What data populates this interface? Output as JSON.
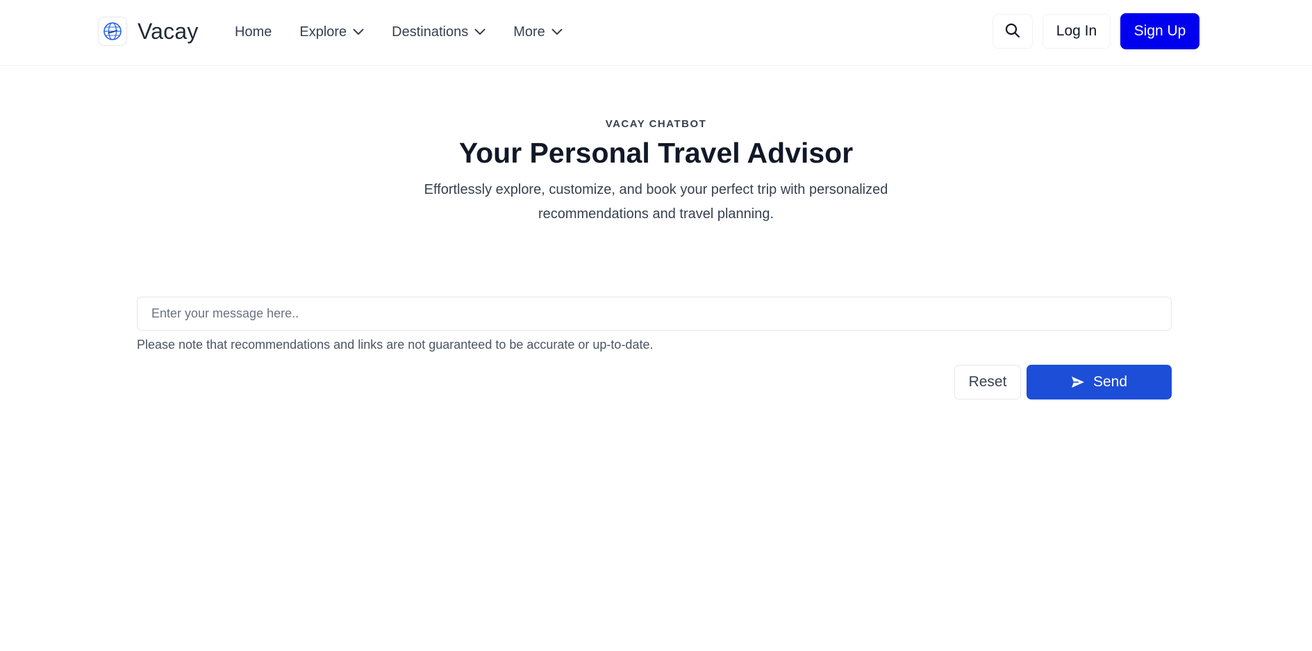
{
  "header": {
    "brand_name": "Vacay",
    "logo_icon": "globe-icon",
    "nav": [
      {
        "label": "Home",
        "has_dropdown": false
      },
      {
        "label": "Explore",
        "has_dropdown": true
      },
      {
        "label": "Destinations",
        "has_dropdown": true
      },
      {
        "label": "More",
        "has_dropdown": true
      }
    ],
    "search_icon": "search-icon",
    "login_label": "Log In",
    "signup_label": "Sign Up"
  },
  "hero": {
    "eyebrow": "VACAY CHATBOT",
    "title": "Your Personal Travel Advisor",
    "subtitle": "Effortlessly explore, customize, and book your perfect trip with personalized recommendations and travel planning."
  },
  "chat": {
    "input_value": "",
    "input_placeholder": "Enter your message here..",
    "disclaimer": "Please note that recommendations and links are not guaranteed to be accurate or up-to-date.",
    "reset_label": "Reset",
    "send_label": "Send",
    "send_icon": "paper-plane-icon"
  },
  "colors": {
    "signup_bg": "#0000ee",
    "send_bg": "#1d4ed8",
    "logo_accent": "#2563eb"
  }
}
